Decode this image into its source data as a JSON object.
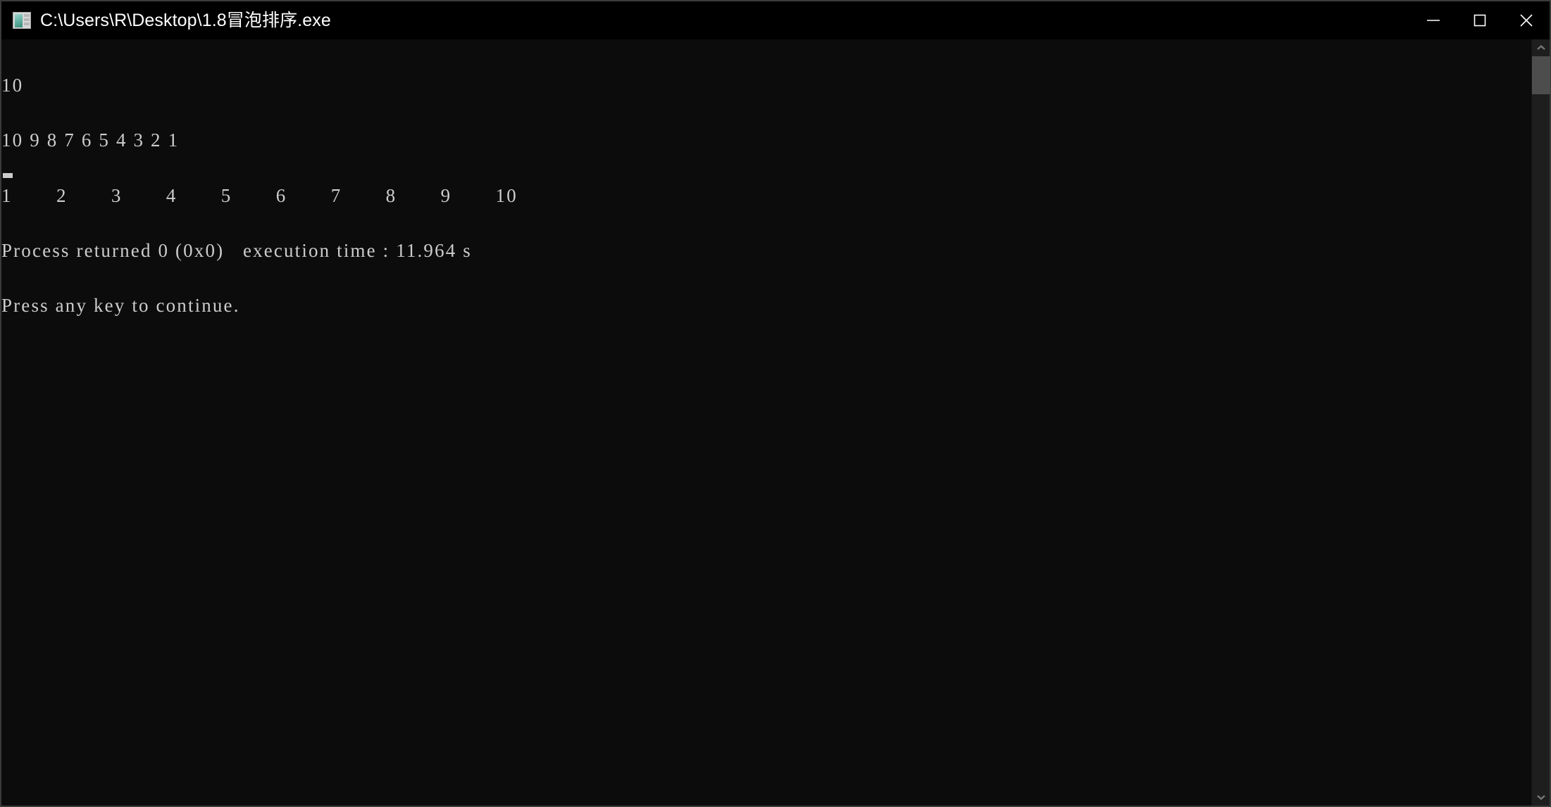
{
  "window": {
    "title": "C:\\Users\\R\\Desktop\\1.8冒泡排序.exe",
    "icon": "console-app-icon",
    "background_color": "#0c0c0c",
    "text_color": "#cccccc",
    "titlebar_color": "#000000",
    "controls": {
      "minimize_label": "Minimize",
      "maximize_label": "Maximize",
      "close_label": "Close"
    }
  },
  "console": {
    "lines": [
      "10",
      "10 9 8 7 6 5 4 3 2 1",
      "1\t2\t3\t4\t5\t6\t7\t8\t9\t10",
      "Process returned 0 (0x0)   execution time : 11.964 s",
      "Press any key to continue."
    ],
    "line_1_count": "10",
    "line_2_input": "10 9 8 7 6 5 4 3 2 1",
    "line_3_sorted": "1\t2\t3\t4\t5\t6\t7\t8\t9\t10",
    "return_code": "0",
    "return_code_hex": "0x0",
    "execution_time": "11.964 s",
    "prompt": "Press any key to continue.",
    "cursor": "block-cursor"
  },
  "scrollbar": {
    "up_arrow": "chevron-up-icon",
    "down_arrow": "chevron-down-icon",
    "thumb": "scrollbar-thumb"
  }
}
